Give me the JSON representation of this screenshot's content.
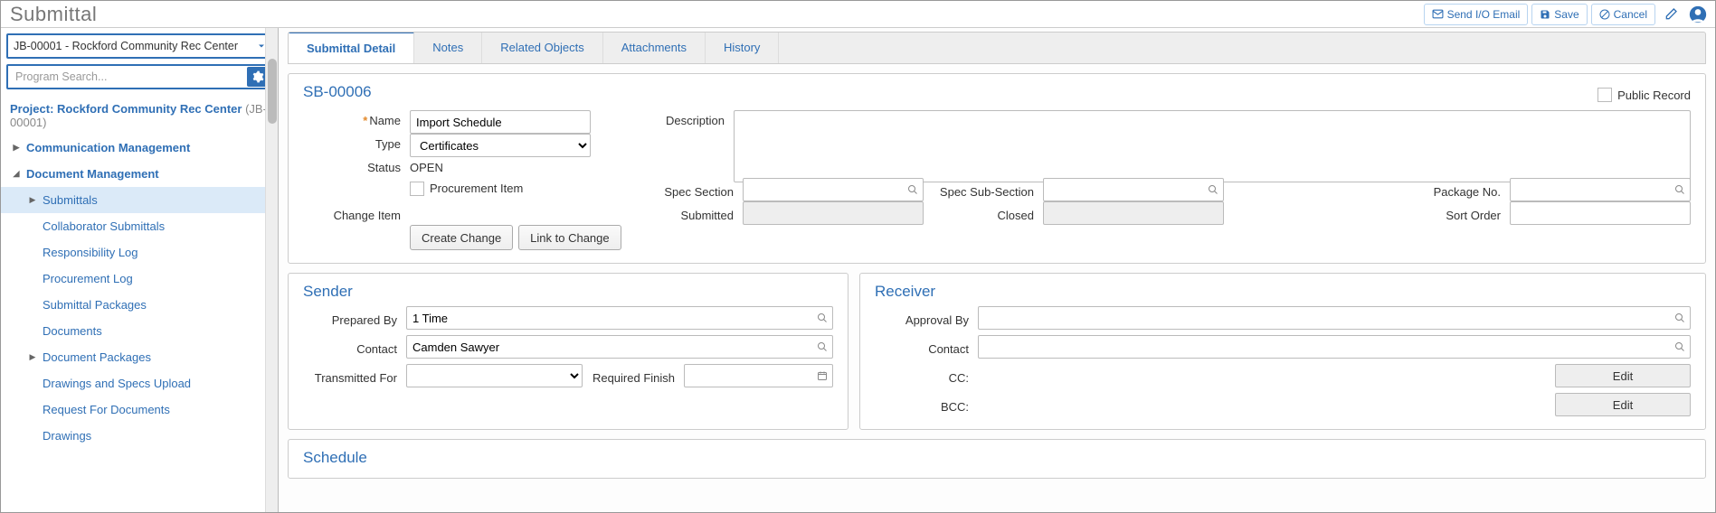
{
  "title": "Submittal",
  "actions": {
    "send_io_email": "Send I/O Email",
    "save": "Save",
    "cancel": "Cancel"
  },
  "program_selector": "JB-00001 - Rockford Community Rec Center",
  "program_search_placeholder": "Program Search...",
  "project": {
    "label": "Project:",
    "name": "Rockford Community Rec Center",
    "id": "(JB-00001)"
  },
  "sidebar": {
    "groups": [
      {
        "label": "Communication Management",
        "expanded": false,
        "children": []
      },
      {
        "label": "Document Management",
        "expanded": true,
        "children": [
          {
            "label": "Submittals",
            "selected": true,
            "caret": true
          },
          {
            "label": "Collaborator Submittals"
          },
          {
            "label": "Responsibility Log"
          },
          {
            "label": "Procurement Log"
          },
          {
            "label": "Submittal Packages"
          },
          {
            "label": "Documents"
          },
          {
            "label": "Document Packages",
            "caret": true
          },
          {
            "label": "Drawings and Specs Upload"
          },
          {
            "label": "Request For Documents"
          },
          {
            "label": "Drawings"
          }
        ]
      }
    ]
  },
  "tabs": [
    "Submittal Detail",
    "Notes",
    "Related Objects",
    "Attachments",
    "History"
  ],
  "active_tab": 0,
  "detail": {
    "id": "SB-00006",
    "public_record_label": "Public Record",
    "name_label": "Name",
    "name_value": "Import Schedule",
    "description_label": "Description",
    "description_value": "",
    "type_label": "Type",
    "type_value": "Certificates",
    "status_label": "Status",
    "status_value": "OPEN",
    "procurement_item_label": "Procurement Item",
    "spec_section_label": "Spec Section",
    "spec_section_value": "",
    "spec_sub_label": "Spec Sub-Section",
    "spec_sub_value": "",
    "package_no_label": "Package No.",
    "package_no_value": "",
    "change_item_label": "Change Item",
    "submitted_label": "Submitted",
    "submitted_value": "",
    "closed_label": "Closed",
    "closed_value": "",
    "sort_order_label": "Sort Order",
    "sort_order_value": "",
    "create_change_btn": "Create Change",
    "link_to_change_btn": "Link to Change"
  },
  "sender": {
    "title": "Sender",
    "prepared_by_label": "Prepared By",
    "prepared_by_value": "1 Time",
    "contact_label": "Contact",
    "contact_value": "Camden Sawyer",
    "transmitted_for_label": "Transmitted For",
    "transmitted_for_value": "",
    "required_finish_label": "Required Finish",
    "required_finish_value": ""
  },
  "receiver": {
    "title": "Receiver",
    "approval_by_label": "Approval By",
    "approval_by_value": "",
    "contact_label": "Contact",
    "contact_value": "",
    "cc_label": "CC:",
    "bcc_label": "BCC:",
    "edit_btn": "Edit"
  },
  "schedule": {
    "title": "Schedule"
  }
}
